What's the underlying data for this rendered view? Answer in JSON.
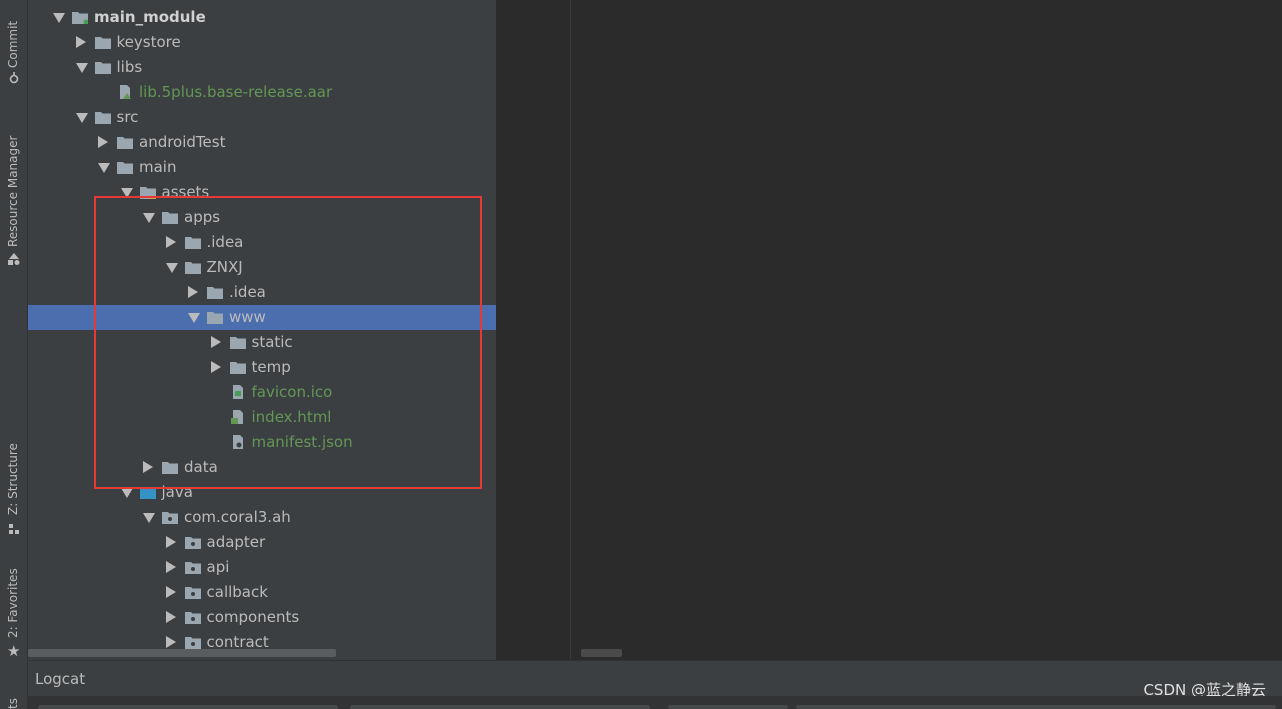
{
  "left_toolbar": {
    "commit": "Commit",
    "resource_manager": "Resource Manager",
    "structure": "Z: Structure",
    "favorites": "2: Favorites",
    "bottom_partial": "ts"
  },
  "tree": {
    "top_partial": "",
    "rows": [
      {
        "label": "main_module",
        "expanded": true,
        "icon": "module-folder-icon",
        "bold": true
      },
      {
        "label": "keystore",
        "expanded": false,
        "icon": "folder-icon"
      },
      {
        "label": "libs",
        "expanded": true,
        "icon": "folder-icon"
      },
      {
        "label": "lib.5plus.base-release.aar",
        "icon": "aar-file-icon",
        "color": "green"
      },
      {
        "label": "src",
        "expanded": true,
        "icon": "folder-icon"
      },
      {
        "label": "androidTest",
        "expanded": false,
        "icon": "folder-icon"
      },
      {
        "label": "main",
        "expanded": true,
        "icon": "folder-icon"
      },
      {
        "label": "assets",
        "expanded": true,
        "icon": "assets-folder-icon"
      },
      {
        "label": "apps",
        "expanded": true,
        "icon": "folder-icon"
      },
      {
        "label": ".idea",
        "expanded": false,
        "icon": "folder-icon"
      },
      {
        "label": "ZNXJ",
        "expanded": true,
        "icon": "folder-icon"
      },
      {
        "label": ".idea",
        "expanded": false,
        "icon": "folder-icon"
      },
      {
        "label": "www",
        "expanded": true,
        "icon": "folder-icon",
        "selected": true
      },
      {
        "label": "static",
        "expanded": false,
        "icon": "folder-icon"
      },
      {
        "label": "temp",
        "expanded": false,
        "icon": "folder-icon"
      },
      {
        "label": "favicon.ico",
        "icon": "image-file-icon",
        "color": "green"
      },
      {
        "label": "index.html",
        "icon": "html-file-icon",
        "color": "green"
      },
      {
        "label": "manifest.json",
        "icon": "json-file-icon",
        "color": "green"
      },
      {
        "label": "data",
        "expanded": false,
        "icon": "folder-icon"
      },
      {
        "label": "java",
        "expanded": true,
        "icon": "source-folder-icon"
      },
      {
        "label": "com.coral3.ah",
        "expanded": true,
        "icon": "package-icon"
      },
      {
        "label": "adapter",
        "expanded": false,
        "icon": "package-icon"
      },
      {
        "label": "api",
        "expanded": false,
        "icon": "package-icon"
      },
      {
        "label": "callback",
        "expanded": false,
        "icon": "package-icon"
      },
      {
        "label": "components",
        "expanded": false,
        "icon": "package-icon"
      },
      {
        "label": "contract",
        "expanded": false,
        "icon": "package-icon"
      }
    ]
  },
  "bottom_panel": {
    "title": "Logcat"
  },
  "watermark": "CSDN @蓝之静云",
  "colors": {
    "selection": "#4b6eaf",
    "highlight_box": "#e53935",
    "green_file": "#629755"
  }
}
